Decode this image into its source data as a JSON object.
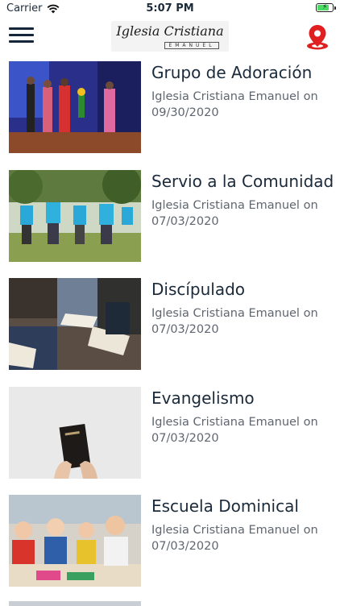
{
  "status_bar": {
    "carrier": "Carrier",
    "time": "5:07 PM",
    "battery_level": 0.8
  },
  "header": {
    "logo_line1": "Iglesia Cristiana",
    "logo_line2": "EMANUEL",
    "menu_icon": "hamburger-menu-icon",
    "location_icon": "map-pin-icon",
    "colors": {
      "menu": "#15263a",
      "pin": "#e02020"
    }
  },
  "posts": [
    {
      "title": "Grupo de Adoración",
      "meta_line1": "Iglesia Cristiana Emanuel on",
      "meta_line2": "09/30/2020"
    },
    {
      "title": "Servio a la Comunidad",
      "meta_line1": "Iglesia Cristiana Emanuel on",
      "meta_line2": "07/03/2020"
    },
    {
      "title": "Discípulado",
      "meta_line1": "Iglesia Cristiana Emanuel on",
      "meta_line2": "07/03/2020"
    },
    {
      "title": "Evangelismo",
      "meta_line1": "Iglesia Cristiana Emanuel on",
      "meta_line2": "07/03/2020"
    },
    {
      "title": "Escuela Dominical",
      "meta_line1": "Iglesia Cristiana Emanuel on",
      "meta_line2": "07/03/2020"
    }
  ]
}
